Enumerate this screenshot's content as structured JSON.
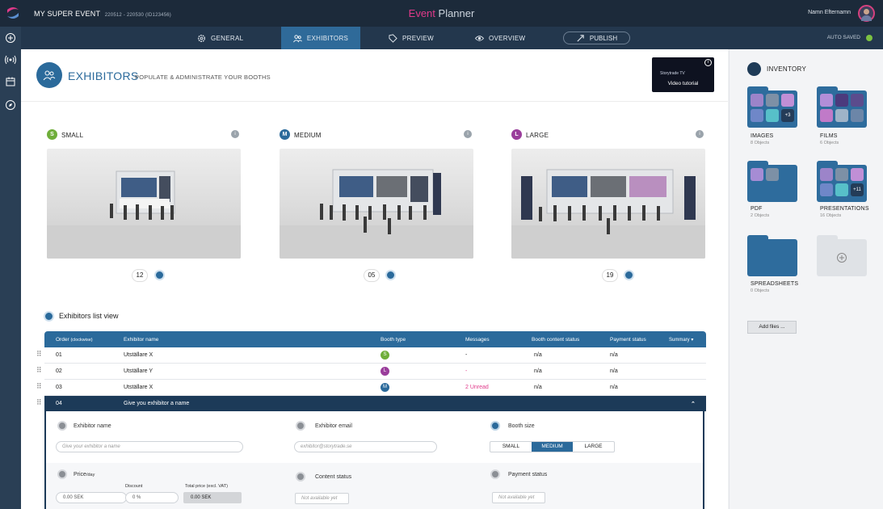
{
  "app": {
    "event_name": "MY SUPER EVENT",
    "event_meta": "220512 - 220530   (ID123456)",
    "title_accent": "Event",
    "title_rest": " Planner",
    "user_name": "Namn Efternamn"
  },
  "nav": {
    "tabs": [
      {
        "label": "GENERAL",
        "icon": "gear-icon"
      },
      {
        "label": "EXHIBITORS",
        "icon": "people-icon",
        "active": true
      },
      {
        "label": "PREVIEW",
        "icon": "tag-icon"
      },
      {
        "label": "OVERVIEW",
        "icon": "eye-icon"
      }
    ],
    "publish_label": "PUBLISH",
    "auto_saved": "AUTO SAVED"
  },
  "rail": [
    "plus-icon",
    "broadcast-icon",
    "calendar-icon",
    "compass-icon"
  ],
  "page": {
    "title": "EXHIBITORS",
    "subtitle": "POPULATE & ADMINISTRATE YOUR BOOTHS",
    "video_brand": "Storytrade TV",
    "video_label": "Video tutorial"
  },
  "booths": [
    {
      "badge": "S",
      "name": "SMALL",
      "count": "12",
      "color": "#6fae3a"
    },
    {
      "badge": "M",
      "name": "MEDIUM",
      "count": "05",
      "color": "#2b6a9b"
    },
    {
      "badge": "L",
      "name": "LARGE",
      "count": "19",
      "color": "#9a3d9b"
    }
  ],
  "list": {
    "title": "Exhibitors list view",
    "headers": {
      "order": "Order",
      "order_hint": "(clockwise)",
      "name": "Exhibitor name",
      "booth": "Booth type",
      "messages": "Messages",
      "content": "Booth content status",
      "payment": "Payment status",
      "summary": "Summary ▾"
    },
    "rows": [
      {
        "order": "01",
        "name": "Utställare X",
        "booth": "S",
        "booth_color": "#6fae3a",
        "messages": "-",
        "content": "n/a",
        "payment": "n/a"
      },
      {
        "order": "02",
        "name": "Utställare Y",
        "booth": "L",
        "booth_color": "#9a3d9b",
        "messages": "-",
        "content": "n/a",
        "payment": "n/a"
      },
      {
        "order": "03",
        "name": "Utställare X",
        "booth": "M",
        "booth_color": "#2b6a9b",
        "messages": "2 Unread",
        "content": "n/a",
        "payment": "n/a"
      }
    ],
    "expanded": {
      "order": "04",
      "name": "Give you exhibitor a name",
      "collapse": "⌃"
    }
  },
  "form": {
    "exhibitor_name_label": "Exhibitor name",
    "exhibitor_name_placeholder": "Give your exhibitor a name",
    "exhibitor_email_label": "Exhibitor email",
    "exhibitor_email_placeholder": "exhibitor@storytrade.se",
    "booth_size_label": "Booth size",
    "booth_sizes": [
      "SMALL",
      "MEDIUM",
      "LARGE"
    ],
    "price_label": "Price",
    "price_unit": "/day",
    "price_value": "0.00 SEK",
    "discount_label": "Discount",
    "discount_value": "0 %",
    "total_label": "Total price (excl. VAT)",
    "total_value": "0.00 SEK",
    "content_status_label": "Content status",
    "content_status_value": "Not available yet",
    "payment_status_label": "Payment status",
    "payment_status_value": "Not available yet"
  },
  "inventory": {
    "title": "INVENTORY",
    "folders": [
      {
        "name": "IMAGES",
        "count": "8 Objects",
        "extra": "+3"
      },
      {
        "name": "FILMS",
        "count": "6 Objects"
      },
      {
        "name": "PDF",
        "count": "2 Objects"
      },
      {
        "name": "PRESENTATIONS",
        "count": "16 Objects",
        "extra": "+11"
      },
      {
        "name": "SPREADSHEETS",
        "count": "0 Objects"
      }
    ],
    "add_files": "Add files ..."
  }
}
